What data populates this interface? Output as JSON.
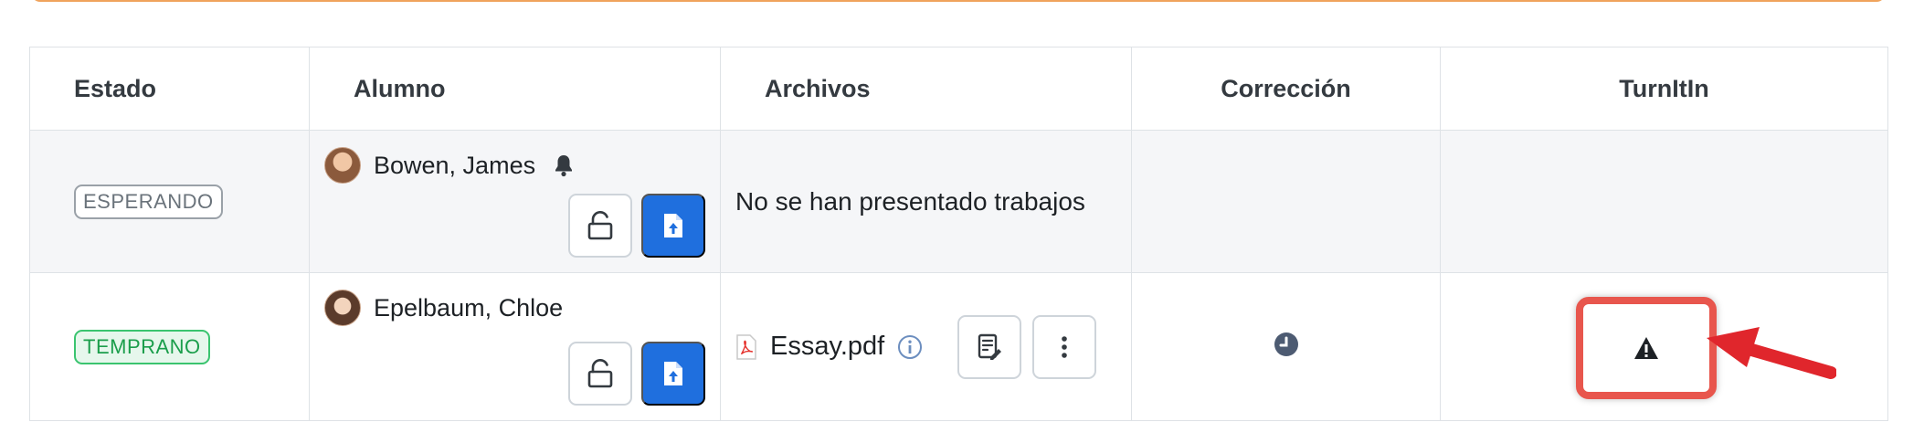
{
  "table": {
    "headers": [
      "Estado",
      "Alumno",
      "Archivos",
      "Corrección",
      "TurnItIn"
    ],
    "rows": [
      {
        "status": "ESPERANDO",
        "student": "Bowen, James",
        "files_text": "No se han presentado trabajos"
      },
      {
        "status": "TEMPRANO",
        "student": "Epelbaum, Chloe",
        "file_name": "Essay.pdf"
      }
    ]
  },
  "icons": {
    "bell": "bell-icon",
    "unlock": "unlock-icon",
    "upload": "file-upload-icon",
    "pdf": "pdf-icon",
    "info": "info-icon",
    "edit": "edit-document-icon",
    "more": "more-vertical-icon",
    "clock": "clock-icon",
    "warning": "warning-icon"
  },
  "colors": {
    "primary": "#1f6fde",
    "early": "#3ac46f",
    "waiting": "#9aa1a8",
    "highlight": "#e8564d",
    "arrow": "#e0262c"
  }
}
